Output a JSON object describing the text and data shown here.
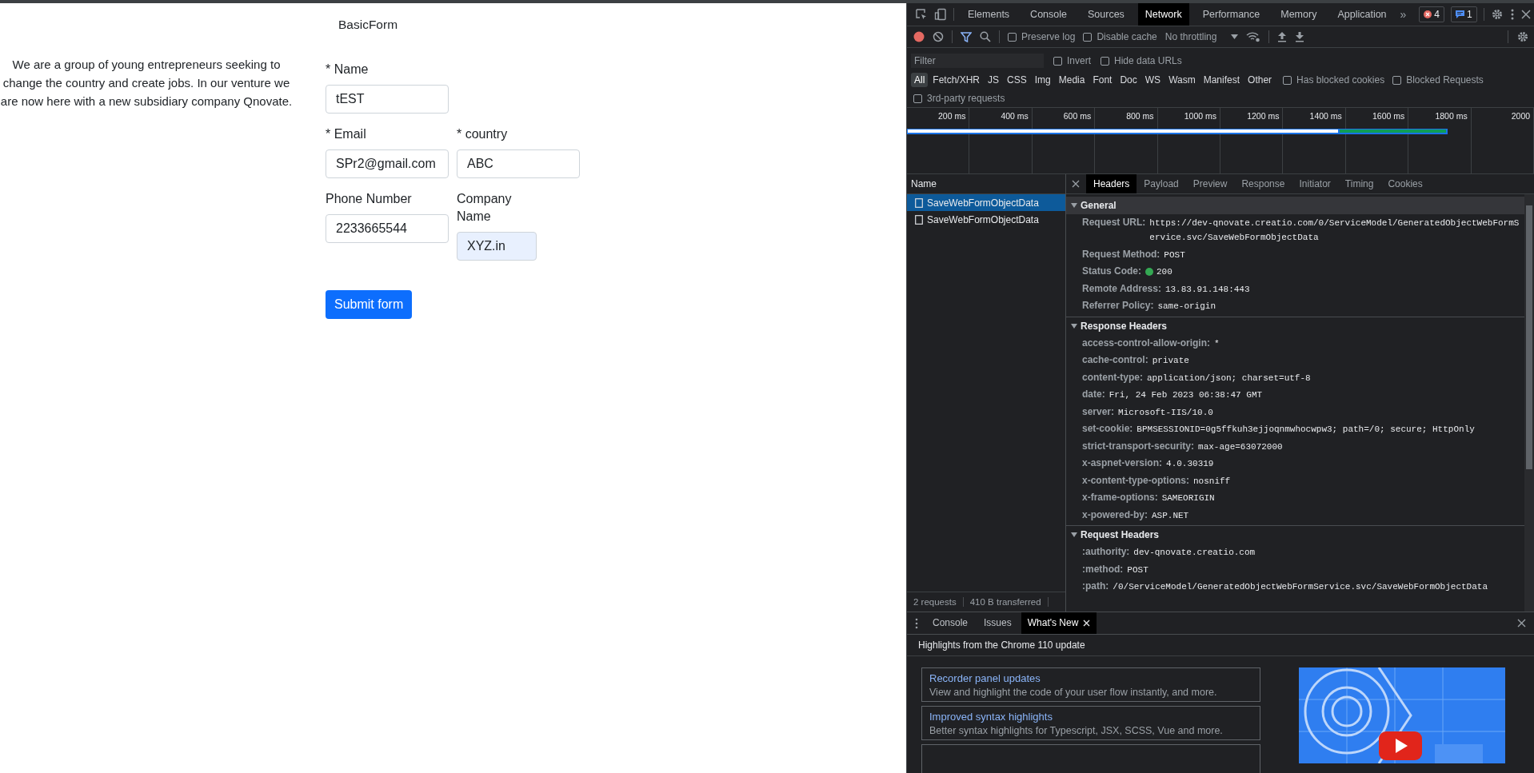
{
  "page": {
    "title": "BasicForm",
    "intro": "We are a group of young entrepreneurs seeking to change the country and create jobs. In our venture we are now here with a new subsidiary company Qnovate.",
    "form_rows": [
      [
        {
          "label": "* Name",
          "value": "tEST",
          "autofilled": false
        }
      ],
      [
        {
          "label": "* Email",
          "value": "SPr2@gmail.com",
          "autofilled": false
        },
        {
          "label": "* country",
          "value": "ABC",
          "autofilled": false
        }
      ],
      [
        {
          "label": "Phone Number",
          "value": "2233665544",
          "autofilled": false
        },
        {
          "label": "Company Name",
          "value": "XYZ.in",
          "autofilled": true
        }
      ]
    ],
    "submit": "Submit form"
  },
  "devtools": {
    "tabs": [
      {
        "label": "Elements",
        "selected": false
      },
      {
        "label": "Console",
        "selected": false
      },
      {
        "label": "Sources",
        "selected": false
      },
      {
        "label": "Network",
        "selected": true
      },
      {
        "label": "Performance",
        "selected": false
      },
      {
        "label": "Memory",
        "selected": false
      },
      {
        "label": "Application",
        "selected": false
      }
    ],
    "more": "»",
    "error_count": "4",
    "message_count": "1",
    "toolbar_checks": [
      {
        "label": "Preserve log",
        "checked": false
      },
      {
        "label": "Disable cache",
        "checked": false
      }
    ],
    "throttling": "No throttling",
    "filter": {
      "placeholder": "Filter"
    },
    "filter_checks": [
      {
        "label": "Invert",
        "checked": false
      },
      {
        "label": "Hide data URLs",
        "checked": false
      }
    ],
    "types": [
      {
        "label": "All",
        "selected": true
      },
      {
        "label": "Fetch/XHR",
        "selected": false
      },
      {
        "label": "JS",
        "selected": false
      },
      {
        "label": "CSS",
        "selected": false
      },
      {
        "label": "Img",
        "selected": false
      },
      {
        "label": "Media",
        "selected": false
      },
      {
        "label": "Font",
        "selected": false
      },
      {
        "label": "Doc",
        "selected": false
      },
      {
        "label": "WS",
        "selected": false
      },
      {
        "label": "Wasm",
        "selected": false
      },
      {
        "label": "Manifest",
        "selected": false
      },
      {
        "label": "Other",
        "selected": false
      }
    ],
    "type_checks": [
      {
        "label": "Has blocked cookies",
        "checked": false
      },
      {
        "label": "Blocked Requests",
        "checked": false
      }
    ],
    "third_party": {
      "label": "3rd-party requests",
      "checked": false
    },
    "timeline_ticks": [
      "200 ms",
      "400 ms",
      "600 ms",
      "800 ms",
      "1000 ms",
      "1200 ms",
      "1400 ms",
      "1600 ms",
      "1800 ms",
      "2000"
    ],
    "requests": {
      "column": "Name",
      "rows": [
        {
          "name": "SaveWebFormObjectData",
          "selected": true
        },
        {
          "name": "SaveWebFormObjectData",
          "selected": false
        }
      ],
      "summary": [
        "2 requests",
        "410 B transferred"
      ]
    },
    "detail_tabs": [
      {
        "label": "Headers",
        "selected": true
      },
      {
        "label": "Payload",
        "selected": false
      },
      {
        "label": "Preview",
        "selected": false
      },
      {
        "label": "Response",
        "selected": false
      },
      {
        "label": "Initiator",
        "selected": false
      },
      {
        "label": "Timing",
        "selected": false
      },
      {
        "label": "Cookies",
        "selected": false
      }
    ],
    "sections": [
      {
        "title": "General",
        "expanded": true,
        "rows": [
          {
            "key": "Request URL:",
            "value": "https://dev-qnovate.creatio.com/0/ServiceModel/GeneratedObjectWebFormService.svc/SaveWebFormObjectData"
          },
          {
            "key": "Request Method:",
            "value": "POST"
          },
          {
            "key": "Status Code:",
            "value": "200",
            "status_dot": true
          },
          {
            "key": "Remote Address:",
            "value": "13.83.91.148:443"
          },
          {
            "key": "Referrer Policy:",
            "value": "same-origin"
          }
        ]
      },
      {
        "title": "Response Headers",
        "expanded": true,
        "rows": [
          {
            "key": "access-control-allow-origin:",
            "value": "*"
          },
          {
            "key": "cache-control:",
            "value": "private"
          },
          {
            "key": "content-type:",
            "value": "application/json; charset=utf-8"
          },
          {
            "key": "date:",
            "value": "Fri, 24 Feb 2023 06:38:47 GMT"
          },
          {
            "key": "server:",
            "value": "Microsoft-IIS/10.0"
          },
          {
            "key": "set-cookie:",
            "value": "BPMSESSIONID=0g5ffkuh3ejjoqnmwhocwpw3; path=/0; secure; HttpOnly"
          },
          {
            "key": "strict-transport-security:",
            "value": "max-age=63072000"
          },
          {
            "key": "x-aspnet-version:",
            "value": "4.0.30319"
          },
          {
            "key": "x-content-type-options:",
            "value": "nosniff"
          },
          {
            "key": "x-frame-options:",
            "value": "SAMEORIGIN"
          },
          {
            "key": "x-powered-by:",
            "value": "ASP.NET"
          }
        ]
      },
      {
        "title": "Request Headers",
        "expanded": true,
        "rows": [
          {
            "key": ":authority:",
            "value": "dev-qnovate.creatio.com"
          },
          {
            "key": ":method:",
            "value": "POST"
          },
          {
            "key": ":path:",
            "value": "/0/ServiceModel/GeneratedObjectWebFormService.svc/SaveWebFormObjectData"
          }
        ]
      }
    ],
    "drawer": {
      "tabs": [
        {
          "label": "Console",
          "selected": false,
          "closable": false
        },
        {
          "label": "Issues",
          "selected": false,
          "closable": false
        },
        {
          "label": "What's New",
          "selected": true,
          "closable": true
        }
      ],
      "heading": "Highlights from the Chrome 110 update",
      "cards": [
        {
          "title": "Recorder panel updates",
          "text": "View and highlight the code of your user flow instantly, and more."
        },
        {
          "title": "Improved syntax highlights",
          "text": "Better syntax highlights for Typescript, JSX, SCSS, Vue and more."
        }
      ]
    }
  }
}
